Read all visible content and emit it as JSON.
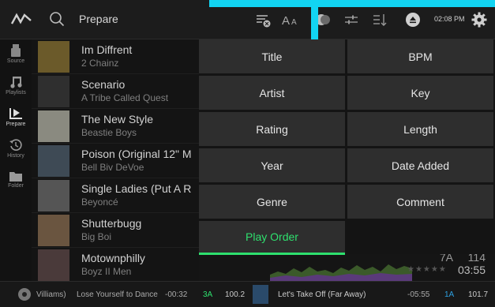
{
  "header": {
    "title": "Prepare",
    "clock": "02:08 PM"
  },
  "sidebar": {
    "items": [
      {
        "label": "Source",
        "icon": "usb-drive-icon"
      },
      {
        "label": "Playlists",
        "icon": "music-note-icon"
      },
      {
        "label": "Prepare",
        "icon": "prepare-icon"
      },
      {
        "label": "History",
        "icon": "history-icon"
      },
      {
        "label": "Folder",
        "icon": "folder-icon"
      }
    ]
  },
  "tracks": [
    {
      "title": "Im Diffrent",
      "artist": "2 Chainz",
      "art": "#6b5a2a"
    },
    {
      "title": "Scenario",
      "artist": "A Tribe Called Quest",
      "art": "#2f2f2f"
    },
    {
      "title": "The New Style",
      "artist": "Beastie Boys",
      "art": "#8a8a80"
    },
    {
      "title": "Poison (Original 12\" M",
      "artist": "Bell Biv DeVoe",
      "art": "#3e4a55"
    },
    {
      "title": "Single Ladies (Put A R",
      "artist": "Beyoncé",
      "art": "#555555"
    },
    {
      "title": "Shutterbugg",
      "artist": "Big Boi",
      "art": "#6a5540"
    },
    {
      "title": "Motownphilly",
      "artist": "Boyz II Men",
      "art": "#4a3a3a"
    }
  ],
  "sort_menu": {
    "options": [
      {
        "label": "Title"
      },
      {
        "label": "BPM"
      },
      {
        "label": "Artist"
      },
      {
        "label": "Key"
      },
      {
        "label": "Rating"
      },
      {
        "label": "Length"
      },
      {
        "label": "Year"
      },
      {
        "label": "Date Added"
      },
      {
        "label": "Genre"
      },
      {
        "label": "Comment"
      },
      {
        "label": "Play Order",
        "selected": true
      }
    ]
  },
  "selected_track_info": {
    "key": "7A",
    "bpm": "114",
    "stars": "★★★★★",
    "length": "03:55"
  },
  "bottom": {
    "left_deck": {
      "artist_fragment": "Villiams)",
      "title": "Lose Yourself to Dance",
      "time": "-00:32",
      "key": "3A",
      "bpm": "100.2"
    },
    "right_deck": {
      "title": "Let's Take Off (Far Away)",
      "time": "-05:55",
      "key": "1A",
      "bpm": "101.7"
    }
  },
  "colors": {
    "accent": "#2ee06e",
    "callout": "#12d4f2"
  }
}
